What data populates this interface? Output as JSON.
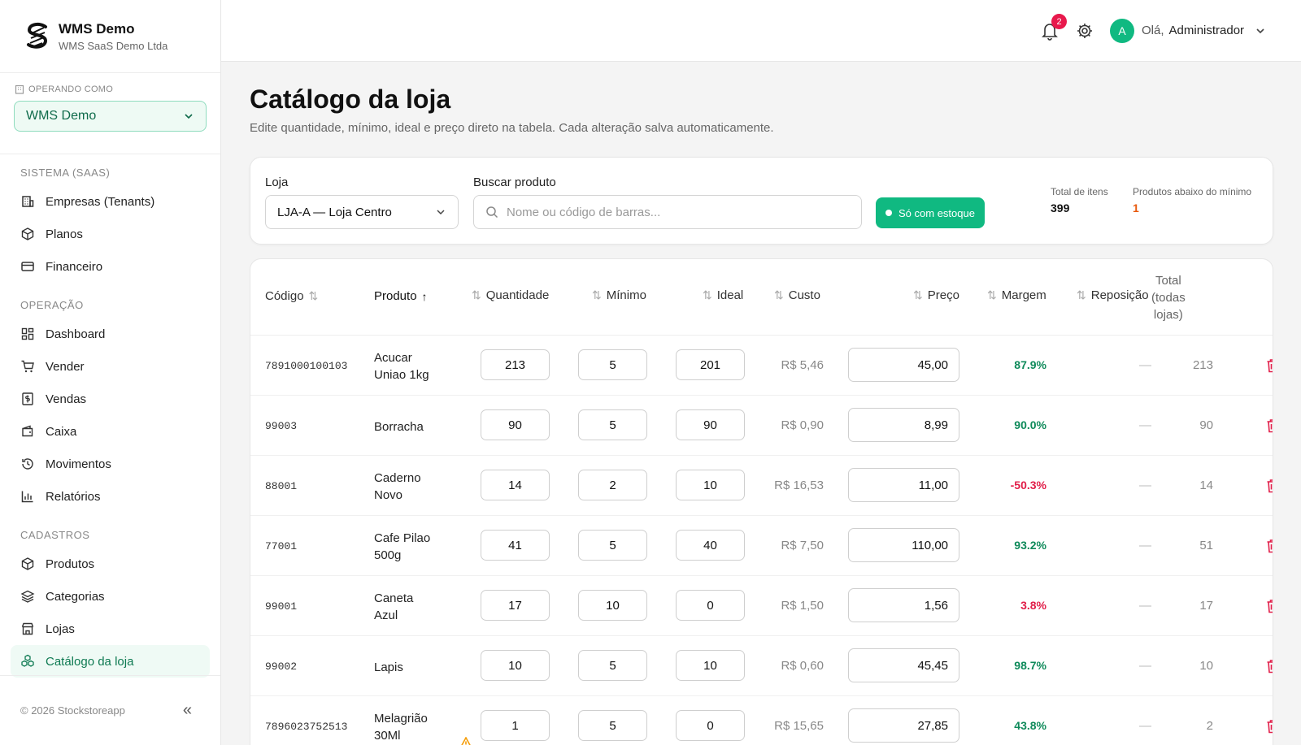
{
  "brand": {
    "name": "WMS Demo",
    "sub": "WMS SaaS Demo Ltda"
  },
  "operating": {
    "label": "OPERANDO COMO",
    "value": "WMS Demo"
  },
  "nav": {
    "section_system": "SISTEMA (SAAS)",
    "system_items": [
      "Empresas (Tenants)",
      "Planos",
      "Financeiro"
    ],
    "section_operation": "OPERAÇÃO",
    "operation_items": [
      "Dashboard",
      "Vender",
      "Vendas",
      "Caixa",
      "Movimentos",
      "Relatórios"
    ],
    "section_registry": "CADASTROS",
    "registry_items": [
      "Produtos",
      "Categorias",
      "Lojas",
      "Catálogo da loja"
    ]
  },
  "footer": {
    "copyright": "© 2026 Stockstoreapp",
    "collapse": "«"
  },
  "header": {
    "notifications": "2",
    "avatar_letter": "A",
    "greeting": "Olá,",
    "user": "Administrador"
  },
  "page": {
    "title": "Catálogo da loja",
    "subtitle": "Edite quantidade, mínimo, ideal e preço direto na tabela. Cada alteração salva automaticamente."
  },
  "filters": {
    "store_label": "Loja",
    "store_value": "LJA-A — Loja Centro",
    "search_label": "Buscar produto",
    "search_placeholder": "Nome ou código de barras...",
    "stock_button": "Só com estoque",
    "total_items_label": "Total de itens",
    "total_items_value": "399",
    "below_min_label": "Produtos abaixo do mínimo",
    "below_min_value": "1"
  },
  "table": {
    "headers": {
      "code": "Código",
      "product": "Produto",
      "quantity": "Quantidade",
      "minimum": "Mínimo",
      "ideal": "Ideal",
      "cost": "Custo",
      "price": "Preço",
      "margin": "Margem",
      "restock": "Reposição",
      "total_1": "Total",
      "total_2": "(todas",
      "total_3": "lojas)"
    },
    "rows": [
      {
        "code": "7891000100103",
        "name1": "Acucar",
        "name2": "Uniao 1kg",
        "qty": "213",
        "min": "5",
        "ideal": "201",
        "cost": "R$ 5,46",
        "price": "45,00",
        "margin": "87.9%",
        "restock": "—",
        "total": "213"
      },
      {
        "code": "99003",
        "name1": "Borracha",
        "name2": "",
        "qty": "90",
        "min": "5",
        "ideal": "90",
        "cost": "R$ 0,90",
        "price": "8,99",
        "margin": "90.0%",
        "restock": "—",
        "total": "90"
      },
      {
        "code": "88001",
        "name1": "Caderno",
        "name2": "Novo",
        "qty": "14",
        "min": "2",
        "ideal": "10",
        "cost": "R$ 16,53",
        "price": "11,00",
        "margin": "-50.3%",
        "restock": "—",
        "total": "14"
      },
      {
        "code": "77001",
        "name1": "Cafe Pilao",
        "name2": "500g",
        "qty": "41",
        "min": "5",
        "ideal": "40",
        "cost": "R$ 7,50",
        "price": "110,00",
        "margin": "93.2%",
        "restock": "—",
        "total": "51"
      },
      {
        "code": "99001",
        "name1": "Caneta",
        "name2": "Azul",
        "qty": "17",
        "min": "10",
        "ideal": "0",
        "cost": "R$ 1,50",
        "price": "1,56",
        "margin": "3.8%",
        "restock": "—",
        "total": "17"
      },
      {
        "code": "99002",
        "name1": "Lapis",
        "name2": "",
        "qty": "10",
        "min": "5",
        "ideal": "10",
        "cost": "R$ 0,60",
        "price": "45,45",
        "margin": "98.7%",
        "restock": "—",
        "total": "10"
      },
      {
        "code": "7896023752513",
        "name1": "Melagrião",
        "name2": "30Ml",
        "qty": "1",
        "min": "5",
        "ideal": "0",
        "cost": "R$ 15,65",
        "price": "27,85",
        "margin": "43.8%",
        "restock": "—",
        "total": "2"
      }
    ]
  },
  "colors": {
    "accent": "#10b981",
    "positive": "#0e8a5a",
    "negative": "#e11d48",
    "warning": "#e8590c"
  }
}
